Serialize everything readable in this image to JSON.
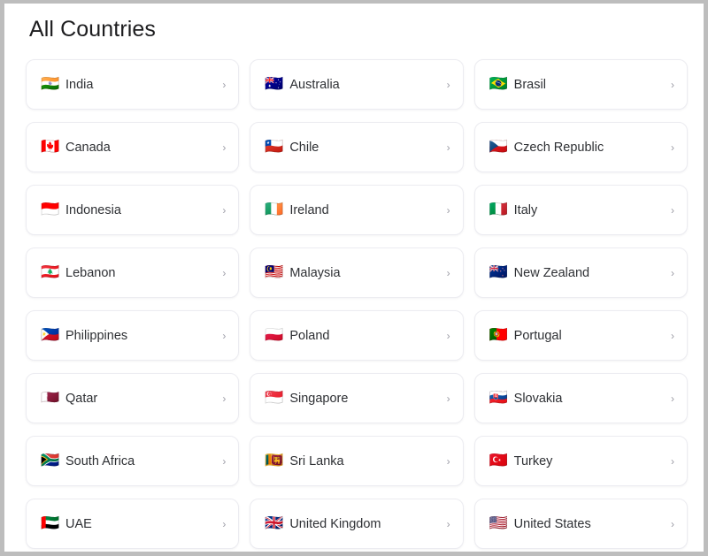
{
  "page": {
    "title": "All Countries",
    "chevron_glyph": "›"
  },
  "countries": [
    {
      "name": "India",
      "flag": "🇮🇳",
      "chevron": "›"
    },
    {
      "name": "Australia",
      "flag": "🇦🇺",
      "chevron": "›"
    },
    {
      "name": "Brasil",
      "flag": "🇧🇷",
      "chevron": "›"
    },
    {
      "name": "Canada",
      "flag": "🇨🇦",
      "chevron": "›"
    },
    {
      "name": "Chile",
      "flag": "🇨🇱",
      "chevron": "›"
    },
    {
      "name": "Czech Republic",
      "flag": "🇨🇿",
      "chevron": "›"
    },
    {
      "name": "Indonesia",
      "flag": "🇮🇩",
      "chevron": "›"
    },
    {
      "name": "Ireland",
      "flag": "🇮🇪",
      "chevron": "›"
    },
    {
      "name": "Italy",
      "flag": "🇮🇹",
      "chevron": "›"
    },
    {
      "name": "Lebanon",
      "flag": "🇱🇧",
      "chevron": "›"
    },
    {
      "name": "Malaysia",
      "flag": "🇲🇾",
      "chevron": "›"
    },
    {
      "name": "New Zealand",
      "flag": "🇳🇿",
      "chevron": "›"
    },
    {
      "name": "Philippines",
      "flag": "🇵🇭",
      "chevron": "›"
    },
    {
      "name": "Poland",
      "flag": "🇵🇱",
      "chevron": "›"
    },
    {
      "name": "Portugal",
      "flag": "🇵🇹",
      "chevron": "›"
    },
    {
      "name": "Qatar",
      "flag": "🇶🇦",
      "chevron": "›"
    },
    {
      "name": "Singapore",
      "flag": "🇸🇬",
      "chevron": "›"
    },
    {
      "name": "Slovakia",
      "flag": "🇸🇰",
      "chevron": "›"
    },
    {
      "name": "South Africa",
      "flag": "🇿🇦",
      "chevron": "›"
    },
    {
      "name": "Sri Lanka",
      "flag": "🇱🇰",
      "chevron": "›"
    },
    {
      "name": "Turkey",
      "flag": "🇹🇷",
      "chevron": "›"
    },
    {
      "name": "UAE",
      "flag": "🇦🇪",
      "chevron": "›"
    },
    {
      "name": "United Kingdom",
      "flag": "🇬🇧",
      "chevron": "›"
    },
    {
      "name": "United States",
      "flag": "🇺🇸",
      "chevron": "›"
    }
  ],
  "colors": {
    "card_background": "#ffffff",
    "card_border": "#ececf1",
    "page_background": "#ffffff",
    "title_text": "#1d1d1f",
    "label_text": "#2e3034",
    "chevron": "#9b9ba5",
    "frame_border": "#bdbdbd"
  }
}
